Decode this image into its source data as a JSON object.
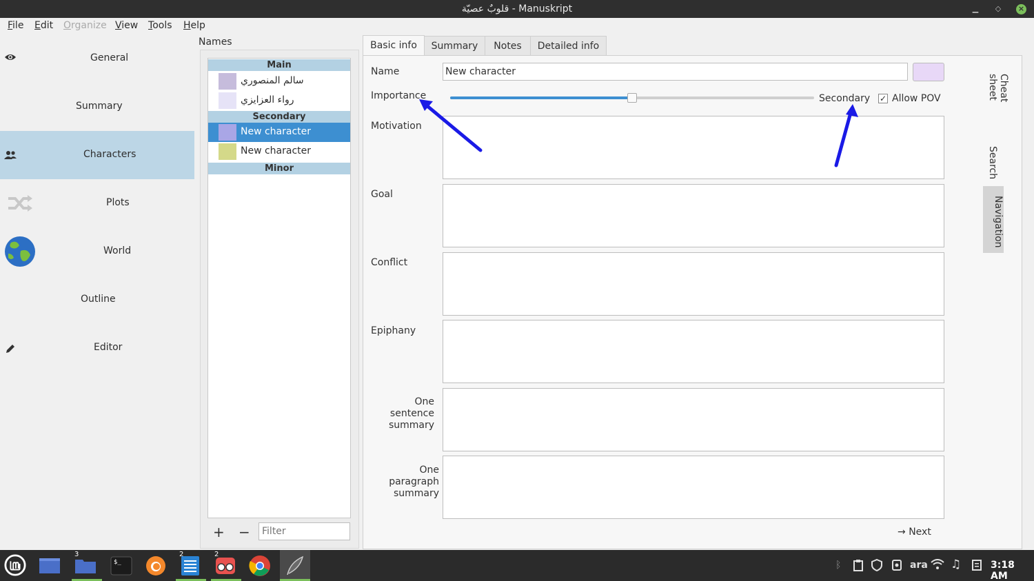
{
  "window": {
    "title": "قلوبٌ عصيّة - Manuskript"
  },
  "menu": [
    "File",
    "Edit",
    "Organize",
    "View",
    "Tools",
    "Help"
  ],
  "nav": {
    "items": [
      {
        "label": "General",
        "icon": "eye-icon"
      },
      {
        "label": "Summary",
        "icon": ""
      },
      {
        "label": "Characters",
        "icon": "people-icon",
        "active": true
      },
      {
        "label": "Plots",
        "icon": "shuffle-icon"
      },
      {
        "label": "World",
        "icon": "globe-icon"
      },
      {
        "label": "Outline",
        "icon": ""
      },
      {
        "label": "Editor",
        "icon": "pencil-icon"
      }
    ]
  },
  "names": {
    "title": "Names",
    "groups": {
      "main": "Main",
      "secondary": "Secondary",
      "minor": "Minor"
    },
    "characters": [
      {
        "name": "سالم المنصوري",
        "color": "#c6bcdc"
      },
      {
        "name": "رواء العزايزي",
        "color": "#e6e3f7"
      },
      {
        "name": "New character",
        "color": "#a9a6e6",
        "selected": true
      },
      {
        "name": "New character",
        "color": "#d4d989"
      }
    ],
    "add_label": "+",
    "remove_label": "−",
    "filter_placeholder": "Filter"
  },
  "tabs": [
    "Basic info",
    "Summary",
    "Notes",
    "Detailed info"
  ],
  "form": {
    "name_label": "Name",
    "name_value": "New character",
    "importance_label": "Importance",
    "importance_value": "Secondary",
    "importance_level": 0.5,
    "allow_pov_label": "Allow POV",
    "allow_pov_checked": true,
    "check_mark": "✓",
    "fields": [
      "Motivation",
      "Goal",
      "Conflict",
      "Epiphany",
      "One sentence summary",
      "One paragraph summary"
    ],
    "next_label": "Next",
    "next_arrow": "→"
  },
  "docks": [
    "Cheat sheet",
    "Search",
    "Navigation"
  ],
  "taskbar": {
    "badges": {
      "files": "3",
      "editor": "2",
      "reader": "2"
    },
    "tray": {
      "lang": "ara"
    },
    "clock": "3:18 AM"
  }
}
